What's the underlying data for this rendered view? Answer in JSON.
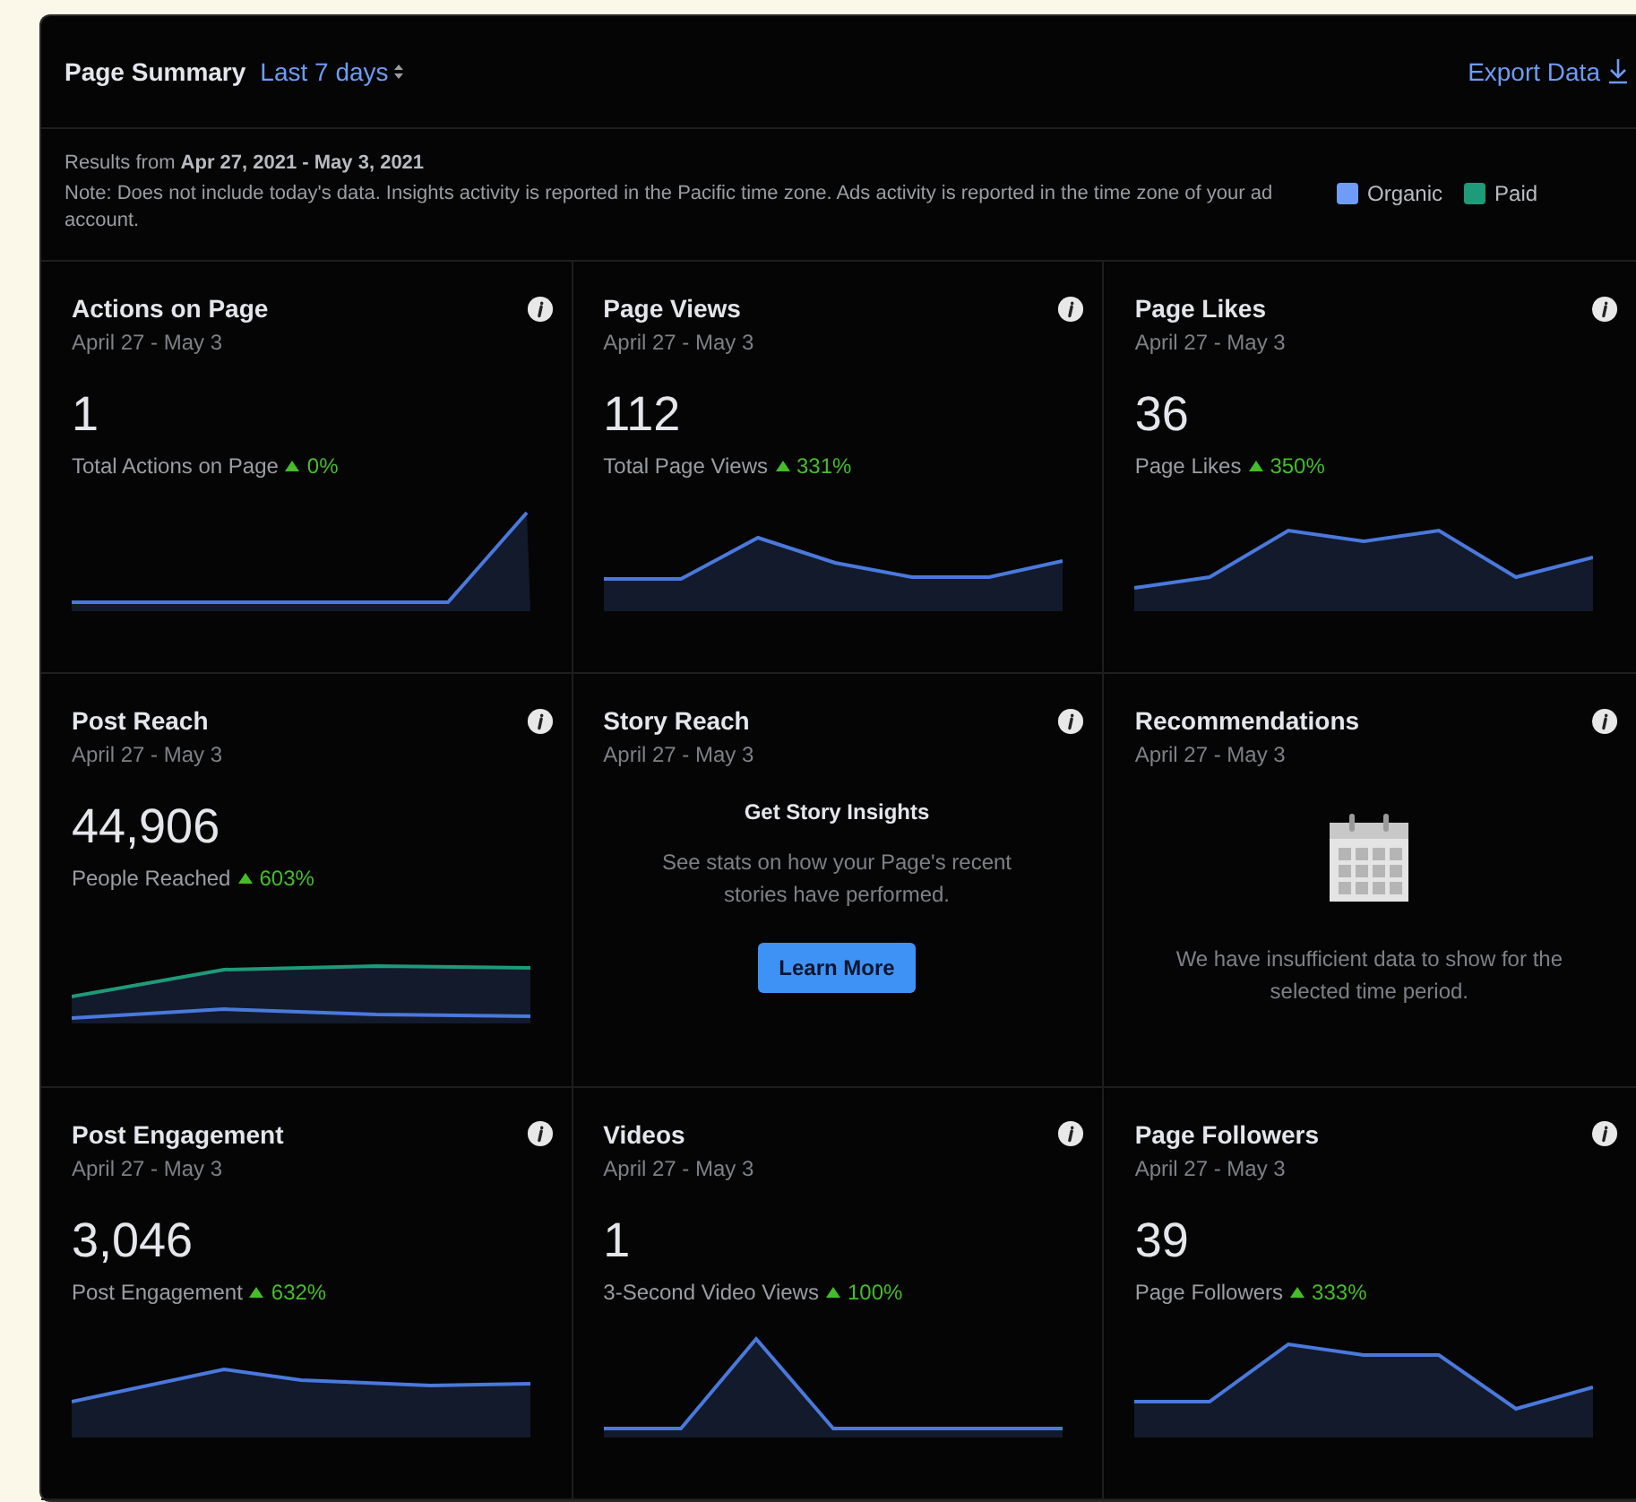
{
  "header": {
    "title": "Page Summary",
    "period": "Last 7 days",
    "export": "Export Data"
  },
  "notes": {
    "results_prefix": "Results from ",
    "results_range": "Apr 27, 2021 - May 3, 2021",
    "note": "Note: Does not include today's data. Insights activity is reported in the Pacific time zone. Ads activity is reported in the time zone of your ad account.",
    "legend": [
      {
        "label": "Organic",
        "color": "#6f9cf7"
      },
      {
        "label": "Paid",
        "color": "#1e9b78"
      }
    ]
  },
  "cards": [
    {
      "kind": "chart",
      "title": "Actions on Page",
      "dates": "April 27 - May 3",
      "value": "1",
      "metric": "Total Actions on Page",
      "change": "0%"
    },
    {
      "kind": "chart",
      "title": "Page Views",
      "dates": "April 27 - May 3",
      "value": "112",
      "metric": "Total Page Views",
      "change": "331%"
    },
    {
      "kind": "chart",
      "title": "Page Likes",
      "dates": "April 27 - May 3",
      "value": "36",
      "metric": "Page Likes",
      "change": "350%"
    },
    {
      "kind": "chart",
      "title": "Post Reach",
      "dates": "April 27 - May 3",
      "value": "44,906",
      "metric": "People Reached",
      "change": "603%"
    },
    {
      "kind": "promo",
      "title": "Story Reach",
      "dates": "April 27 - May 3",
      "heading": "Get Story Insights",
      "body": "See stats on how your Page's recent stories have performed.",
      "button": "Learn More"
    },
    {
      "kind": "empty",
      "title": "Recommendations",
      "dates": "April 27 - May 3",
      "body": "We have insufficient data to show for the selected time period."
    },
    {
      "kind": "chart",
      "title": "Post Engagement",
      "dates": "April 27 - May 3",
      "value": "3,046",
      "metric": "Post Engagement",
      "change": "632%"
    },
    {
      "kind": "chart",
      "title": "Videos",
      "dates": "April 27 - May 3",
      "value": "1",
      "metric": "3-Second Video Views",
      "change": "100%"
    },
    {
      "kind": "chart",
      "title": "Page Followers",
      "dates": "April 27 - May 3",
      "value": "39",
      "metric": "Page Followers",
      "change": "333%"
    }
  ]
}
